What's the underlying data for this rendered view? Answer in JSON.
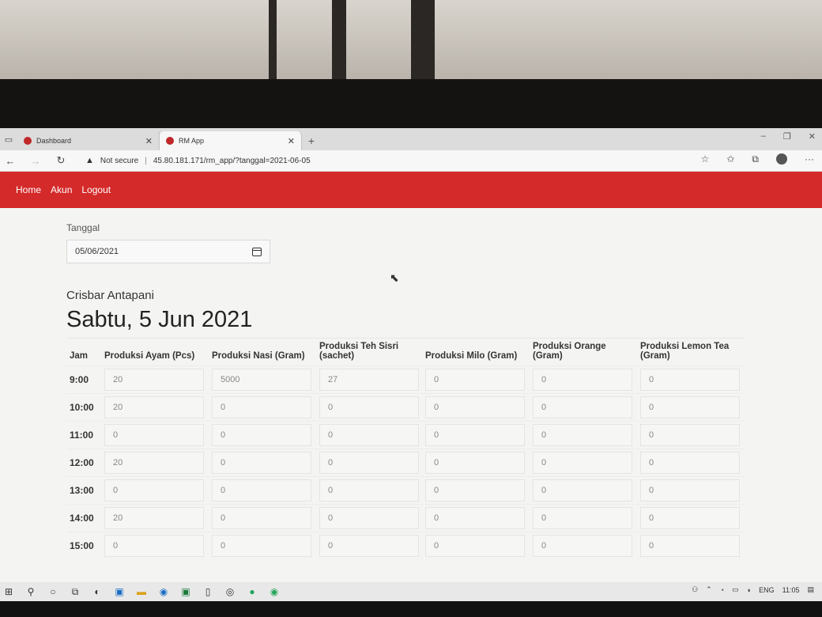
{
  "browser": {
    "tabs": [
      {
        "title": "Dashboard",
        "active": false
      },
      {
        "title": "RM App",
        "active": true
      }
    ],
    "security": "Not secure",
    "url": "45.80.181.171/rm_app/?tanggal=2021-06-05"
  },
  "nav": {
    "home": "Home",
    "akun": "Akun",
    "logout": "Logout"
  },
  "form": {
    "date_label": "Tanggal",
    "date_value": "05/06/2021"
  },
  "branch_name": "Crisbar Antapani",
  "day_title": "Sabtu, 5 Jun 2021",
  "table": {
    "headers": [
      "Jam",
      "Produksi Ayam (Pcs)",
      "Produksi Nasi (Gram)",
      "Produksi Teh Sisri (sachet)",
      "Produksi Milo (Gram)",
      "Produksi Orange (Gram)",
      "Produksi Lemon Tea (Gram)"
    ],
    "rows": [
      {
        "jam": "9:00",
        "values": [
          "20",
          "5000",
          "27",
          "0",
          "0",
          "0"
        ]
      },
      {
        "jam": "10:00",
        "values": [
          "20",
          "0",
          "0",
          "0",
          "0",
          "0"
        ]
      },
      {
        "jam": "11:00",
        "values": [
          "0",
          "0",
          "0",
          "0",
          "0",
          "0"
        ]
      },
      {
        "jam": "12:00",
        "values": [
          "20",
          "0",
          "0",
          "0",
          "0",
          "0"
        ]
      },
      {
        "jam": "13:00",
        "values": [
          "0",
          "0",
          "0",
          "0",
          "0",
          "0"
        ]
      },
      {
        "jam": "14:00",
        "values": [
          "20",
          "0",
          "0",
          "0",
          "0",
          "0"
        ]
      },
      {
        "jam": "15:00",
        "values": [
          "0",
          "0",
          "0",
          "0",
          "0",
          "0"
        ]
      }
    ]
  },
  "taskbar": {
    "lang": "ENG",
    "time": "11:05"
  },
  "colors": {
    "nav_red": "#d42a2a"
  }
}
